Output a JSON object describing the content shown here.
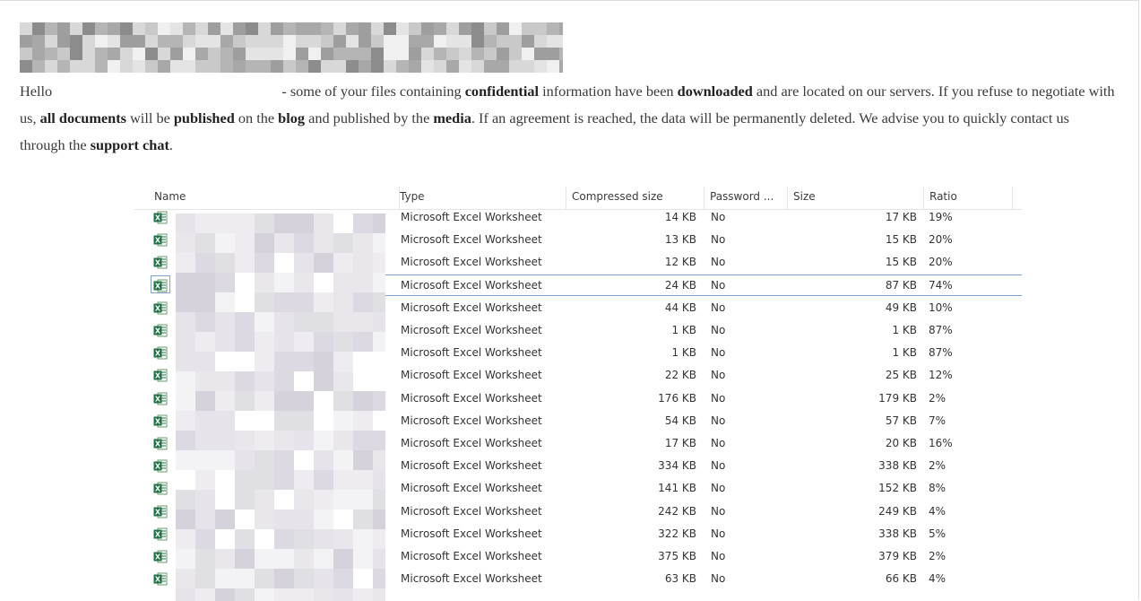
{
  "message": {
    "greeting": "Hello",
    "p1": " - some of your files containing ",
    "b1": "confidential",
    "p2": " information have been ",
    "b2": "downloaded",
    "p3": " and are located on our servers. If you refuse to negotiate with us, ",
    "b3": "all documents",
    "p4": " will be ",
    "b4": "published",
    "p5": " on the ",
    "b5": "blog",
    "p6": " and published by the ",
    "b6": "media",
    "p7": ". If an agreement is reached, the data will be permanently deleted. We advise you to quickly contact us through the ",
    "b7": "support chat",
    "p8": "."
  },
  "table": {
    "columns": [
      "Name",
      "Type",
      "Compressed size",
      "Password ...",
      "Size",
      "Ratio"
    ],
    "selected_row": 3,
    "rows": [
      {
        "type": "Microsoft Excel Worksheet",
        "compressed": "14 KB",
        "password": "No",
        "size": "17 KB",
        "ratio": "19%"
      },
      {
        "type": "Microsoft Excel Worksheet",
        "compressed": "13 KB",
        "password": "No",
        "size": "15 KB",
        "ratio": "20%"
      },
      {
        "type": "Microsoft Excel Worksheet",
        "compressed": "12 KB",
        "password": "No",
        "size": "15 KB",
        "ratio": "20%"
      },
      {
        "type": "Microsoft Excel Worksheet",
        "compressed": "24 KB",
        "password": "No",
        "size": "87 KB",
        "ratio": "74%"
      },
      {
        "type": "Microsoft Excel Worksheet",
        "compressed": "44 KB",
        "password": "No",
        "size": "49 KB",
        "ratio": "10%"
      },
      {
        "type": "Microsoft Excel Worksheet",
        "compressed": "1 KB",
        "password": "No",
        "size": "1 KB",
        "ratio": "87%"
      },
      {
        "type": "Microsoft Excel Worksheet",
        "compressed": "1 KB",
        "password": "No",
        "size": "1 KB",
        "ratio": "87%"
      },
      {
        "type": "Microsoft Excel Worksheet",
        "compressed": "22 KB",
        "password": "No",
        "size": "25 KB",
        "ratio": "12%"
      },
      {
        "type": "Microsoft Excel Worksheet",
        "compressed": "176 KB",
        "password": "No",
        "size": "179 KB",
        "ratio": "2%"
      },
      {
        "type": "Microsoft Excel Worksheet",
        "compressed": "54 KB",
        "password": "No",
        "size": "57 KB",
        "ratio": "7%"
      },
      {
        "type": "Microsoft Excel Worksheet",
        "compressed": "17 KB",
        "password": "No",
        "size": "20 KB",
        "ratio": "16%"
      },
      {
        "type": "Microsoft Excel Worksheet",
        "compressed": "334 KB",
        "password": "No",
        "size": "338 KB",
        "ratio": "2%"
      },
      {
        "type": "Microsoft Excel Worksheet",
        "compressed": "141 KB",
        "password": "No",
        "size": "152 KB",
        "ratio": "8%"
      },
      {
        "type": "Microsoft Excel Worksheet",
        "compressed": "242 KB",
        "password": "No",
        "size": "249 KB",
        "ratio": "4%"
      },
      {
        "type": "Microsoft Excel Worksheet",
        "compressed": "322 KB",
        "password": "No",
        "size": "338 KB",
        "ratio": "5%"
      },
      {
        "type": "Microsoft Excel Worksheet",
        "compressed": "375 KB",
        "password": "No",
        "size": "379 KB",
        "ratio": "2%"
      },
      {
        "type": "Microsoft Excel Worksheet",
        "compressed": "63 KB",
        "password": "No",
        "size": "66 KB",
        "ratio": "4%"
      }
    ]
  },
  "icons": {
    "file": "excel-file-icon"
  },
  "colors": {
    "excel_green": "#1e7145",
    "selection_border": "#7da2ce"
  }
}
